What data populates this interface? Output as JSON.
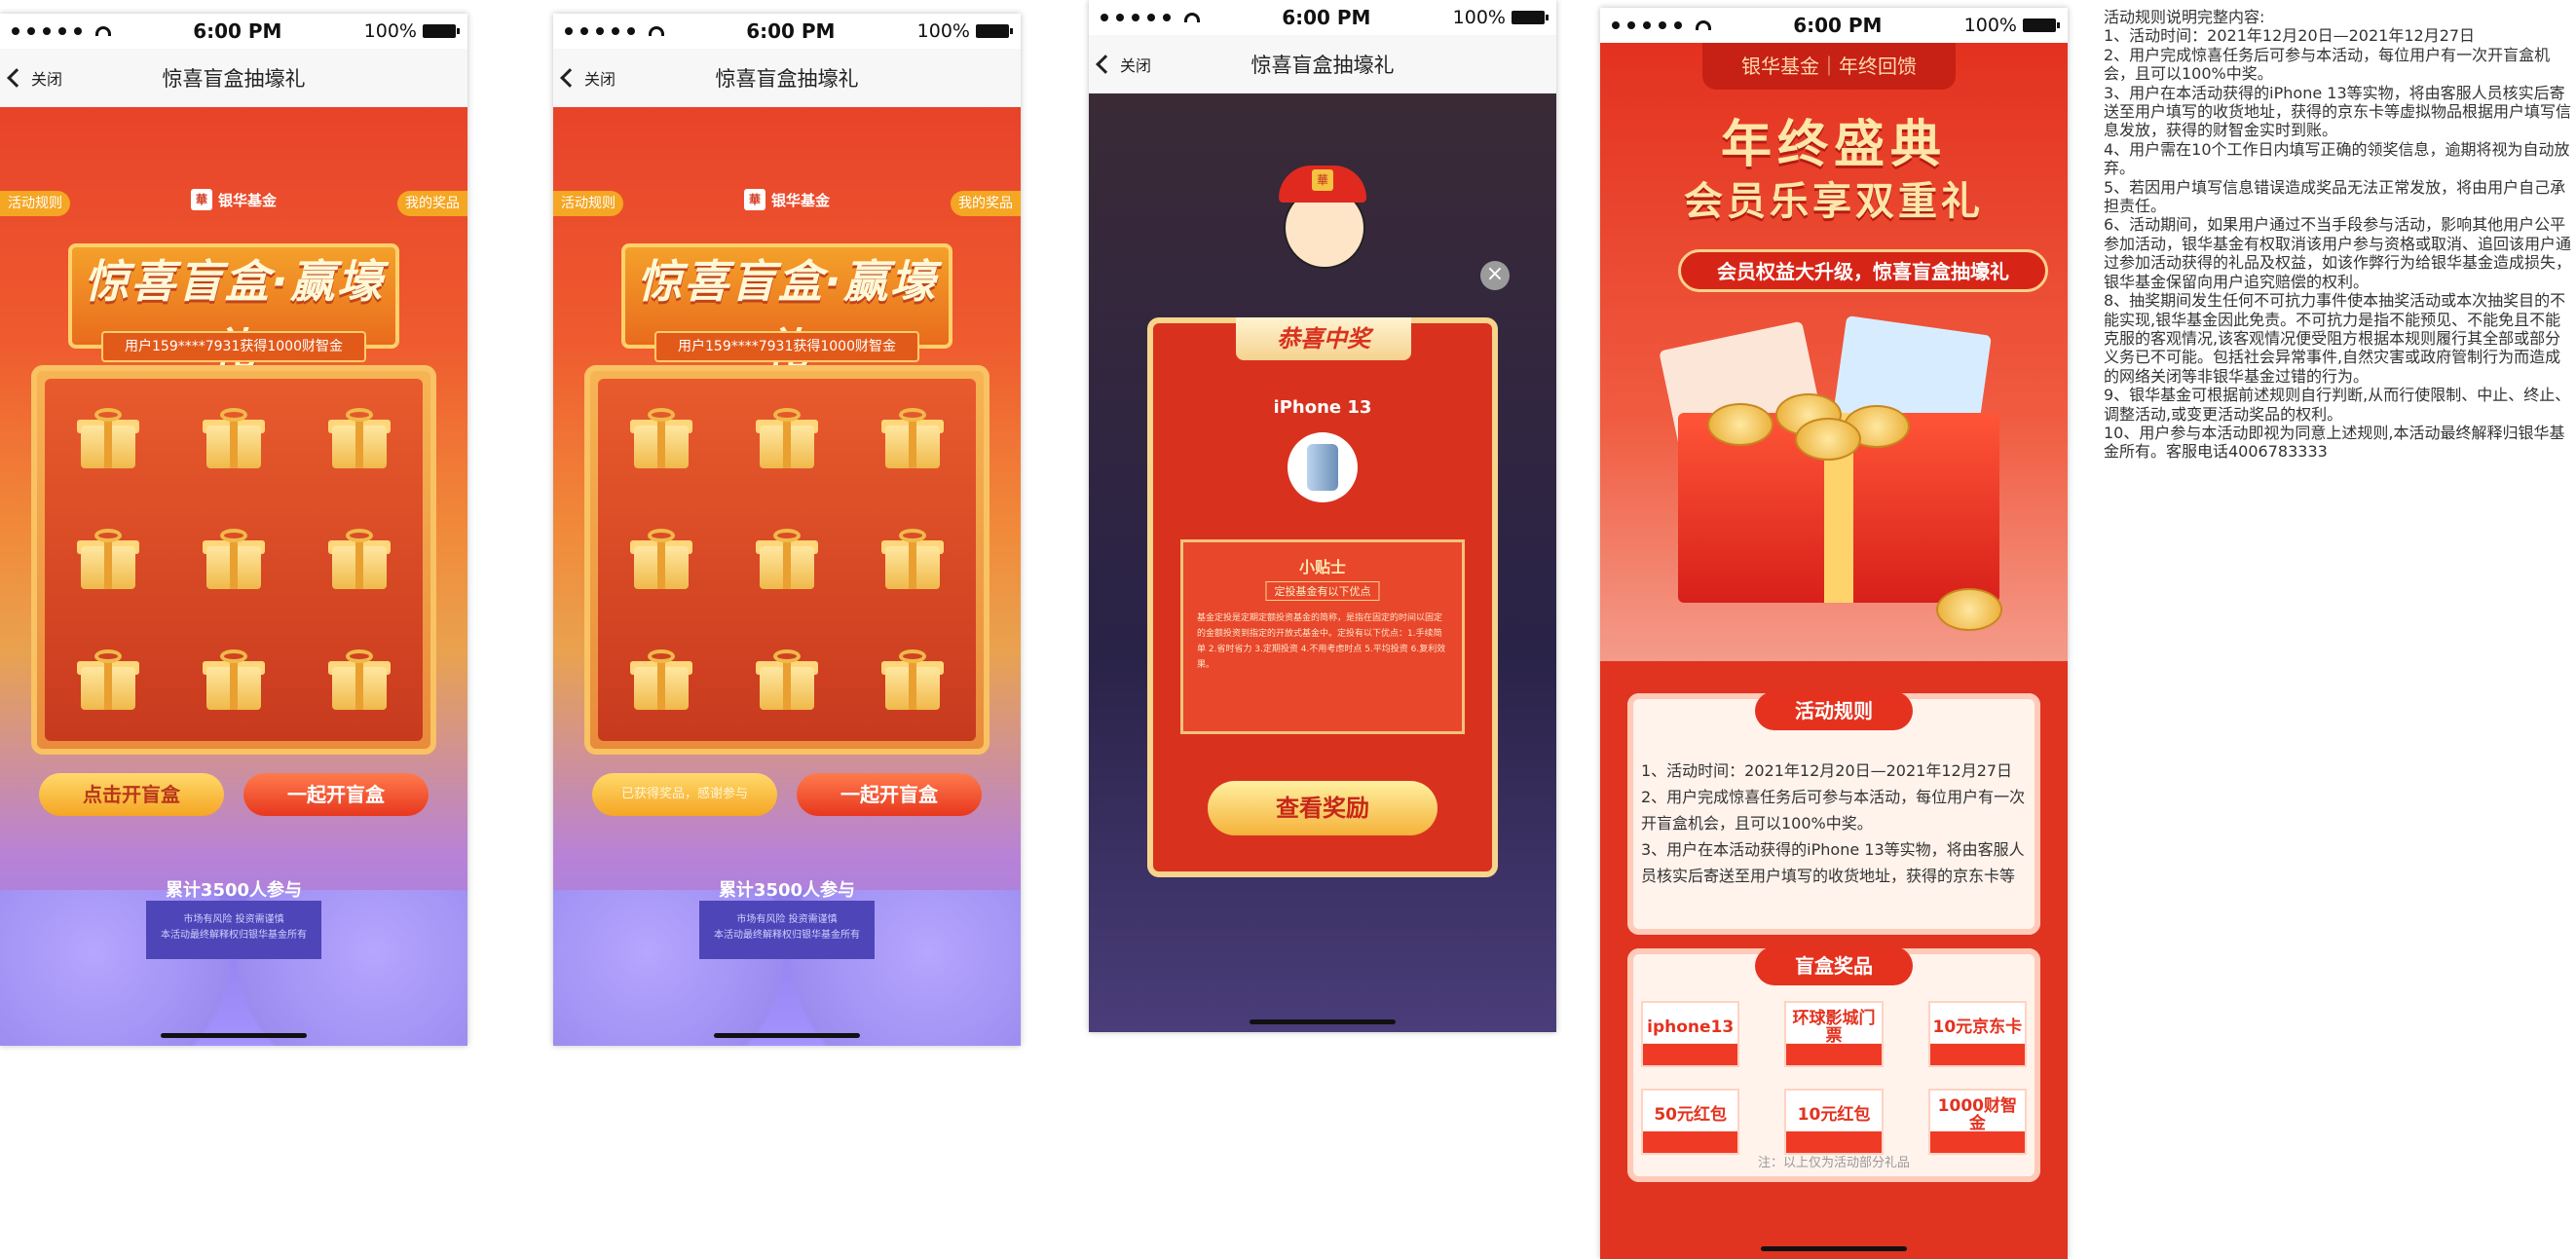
{
  "status": {
    "time": "6:00 PM",
    "battery": "100%"
  },
  "nav": {
    "back": "关闭",
    "title": "惊喜盲盒抽壕礼"
  },
  "game": {
    "rules_tag": "活动规则",
    "prizes_tag": "我的奖品",
    "brand": "银华基金",
    "brand_seal": "華",
    "title": "惊喜盲盒·赢壕礼",
    "notice": "用户159****7931获得1000财智金",
    "btn_open": "点击开盲盒",
    "btn_open_disabled": "已获得奖品，感谢参与",
    "btn_together": "一起开盲盒",
    "participants": "累计3500人参与",
    "risk_line1": "市场有风险 投资需谨慎",
    "risk_line2": "本活动最终解释权归银华基金所有"
  },
  "popup": {
    "congrats": "恭喜中奖",
    "prize": "iPhone 13",
    "tips_title": "小贴士",
    "tips_sub": "定投基金有以下优点",
    "tips_text": "基金定投是定期定额投资基金的简称，是指在固定的时间以固定的金额投资到指定的开放式基金中。定投有以下优点：1.手续简单 2.省时省力 3.定期投资 4.不用考虑时点 5.平均投资 6.复利效果。",
    "view_btn": "查看奖励",
    "hat_badge": "華"
  },
  "long": {
    "tab": "银华基金｜年终回馈",
    "title1": "年终盛典",
    "title2": "会员乐享双重礼",
    "banner": "会员权益大升级，惊喜盲盒抽壕礼",
    "rules_head": "活动规则",
    "rules": [
      "1、活动时间：2021年12月20日—2021年12月27日",
      "2、用户完成惊喜任务后可参与本活动，每位用户有一次开盲盒机会，且可以100%中奖。",
      "3、用户在本活动获得的iPhone 13等实物，将由客服人员核实后寄送至用户填写的收货地址，获得的京东卡等"
    ],
    "prizes_head": "盲盒奖品",
    "prizes": [
      "iphone13",
      "环球影城门票",
      "10元京东卡",
      "50元红包",
      "10元红包",
      "1000财智金"
    ],
    "note": "注：以上仅为活动部分礼品"
  },
  "rules_full": [
    "活动规则说明完整内容:",
    "1、活动时间：2021年12月20日—2021年12月27日",
    "2、用户完成惊喜任务后可参与本活动，每位用户有一次开盲盒机会，且可以100%中奖。",
    "3、用户在本活动获得的iPhone 13等实物，将由客服人员核实后寄送至用户填写的收货地址，获得的京东卡等虚拟物品根据用户填写信息发放，获得的财智金实时到账。",
    "4、用户需在10个工作日内填写正确的领奖信息，逾期将视为自动放弃。",
    "5、若因用户填写信息错误造成奖品无法正常发放，将由用户自己承担责任。",
    "6、活动期间，如果用户通过不当手段参与活动，影响其他用户公平参加活动，银华基金有权取消该用户参与资格或取消、追回该用户通过参加活动获得的礼品及权益，如该作弊行为给银华基金造成损失，银华基金保留向用户追究赔偿的权利。",
    "8、抽奖期间发生任何不可抗力事件使本抽奖活动或本次抽奖目的不能实现,银华基金因此免责。不可抗力是指不能预见、不能免且不能克服的客观情况,该客观情况便受阻方根据本规则履行其全部或部分义务已不可能。包括社会异常事件,自然灾害或政府管制行为而造成的网络关闭等非银华基金过错的行为。",
    "9、银华基金可根据前述规则自行判断,从而行使限制、中止、终止、调整活动,或变更活动奖品的权利。",
    "10、用户参与本活动即视为同意上述规则,本活动最终解释归银华基金所有。客服电话4006783333"
  ]
}
